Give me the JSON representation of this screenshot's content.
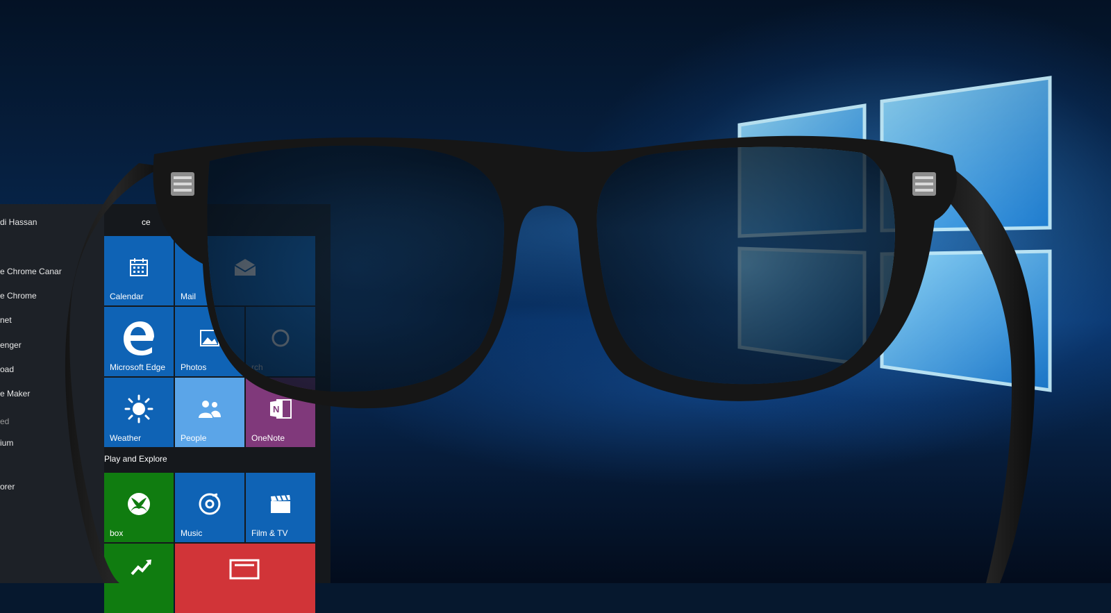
{
  "start_menu": {
    "user_name": "di Hassan",
    "apps": [
      {
        "label": "e Chrome Canar"
      },
      {
        "label": "e Chrome"
      },
      {
        "label": "net"
      },
      {
        "label": "enger"
      },
      {
        "label": "oad"
      },
      {
        "label": "e Maker"
      },
      {
        "label": "ed"
      },
      {
        "label": "ium"
      },
      {
        "label": "orer"
      }
    ],
    "group_life": "ce",
    "group_play": "Play and Explore",
    "tiles": {
      "calendar": "Calendar",
      "mail": "Mail",
      "edge": "Microsoft Edge",
      "photos": "Photos",
      "search": "rch",
      "weather": "Weather",
      "people": "People",
      "onenote": "OneNote",
      "xbox": "box",
      "music": "Music",
      "film": "Film & TV"
    }
  },
  "colors": {
    "tile_blue": "#0f63b5",
    "tile_light_blue": "#5ba5e8",
    "tile_purple": "#80397b",
    "tile_green": "#107c10",
    "tile_red": "#d13438"
  },
  "icons": [
    "windows-logo-icon",
    "calendar-icon",
    "mail-icon",
    "edge-icon",
    "photos-icon",
    "cortana-icon",
    "weather-icon",
    "people-icon",
    "onenote-icon",
    "xbox-icon",
    "music-icon",
    "film-icon",
    "money-icon",
    "news-icon"
  ]
}
